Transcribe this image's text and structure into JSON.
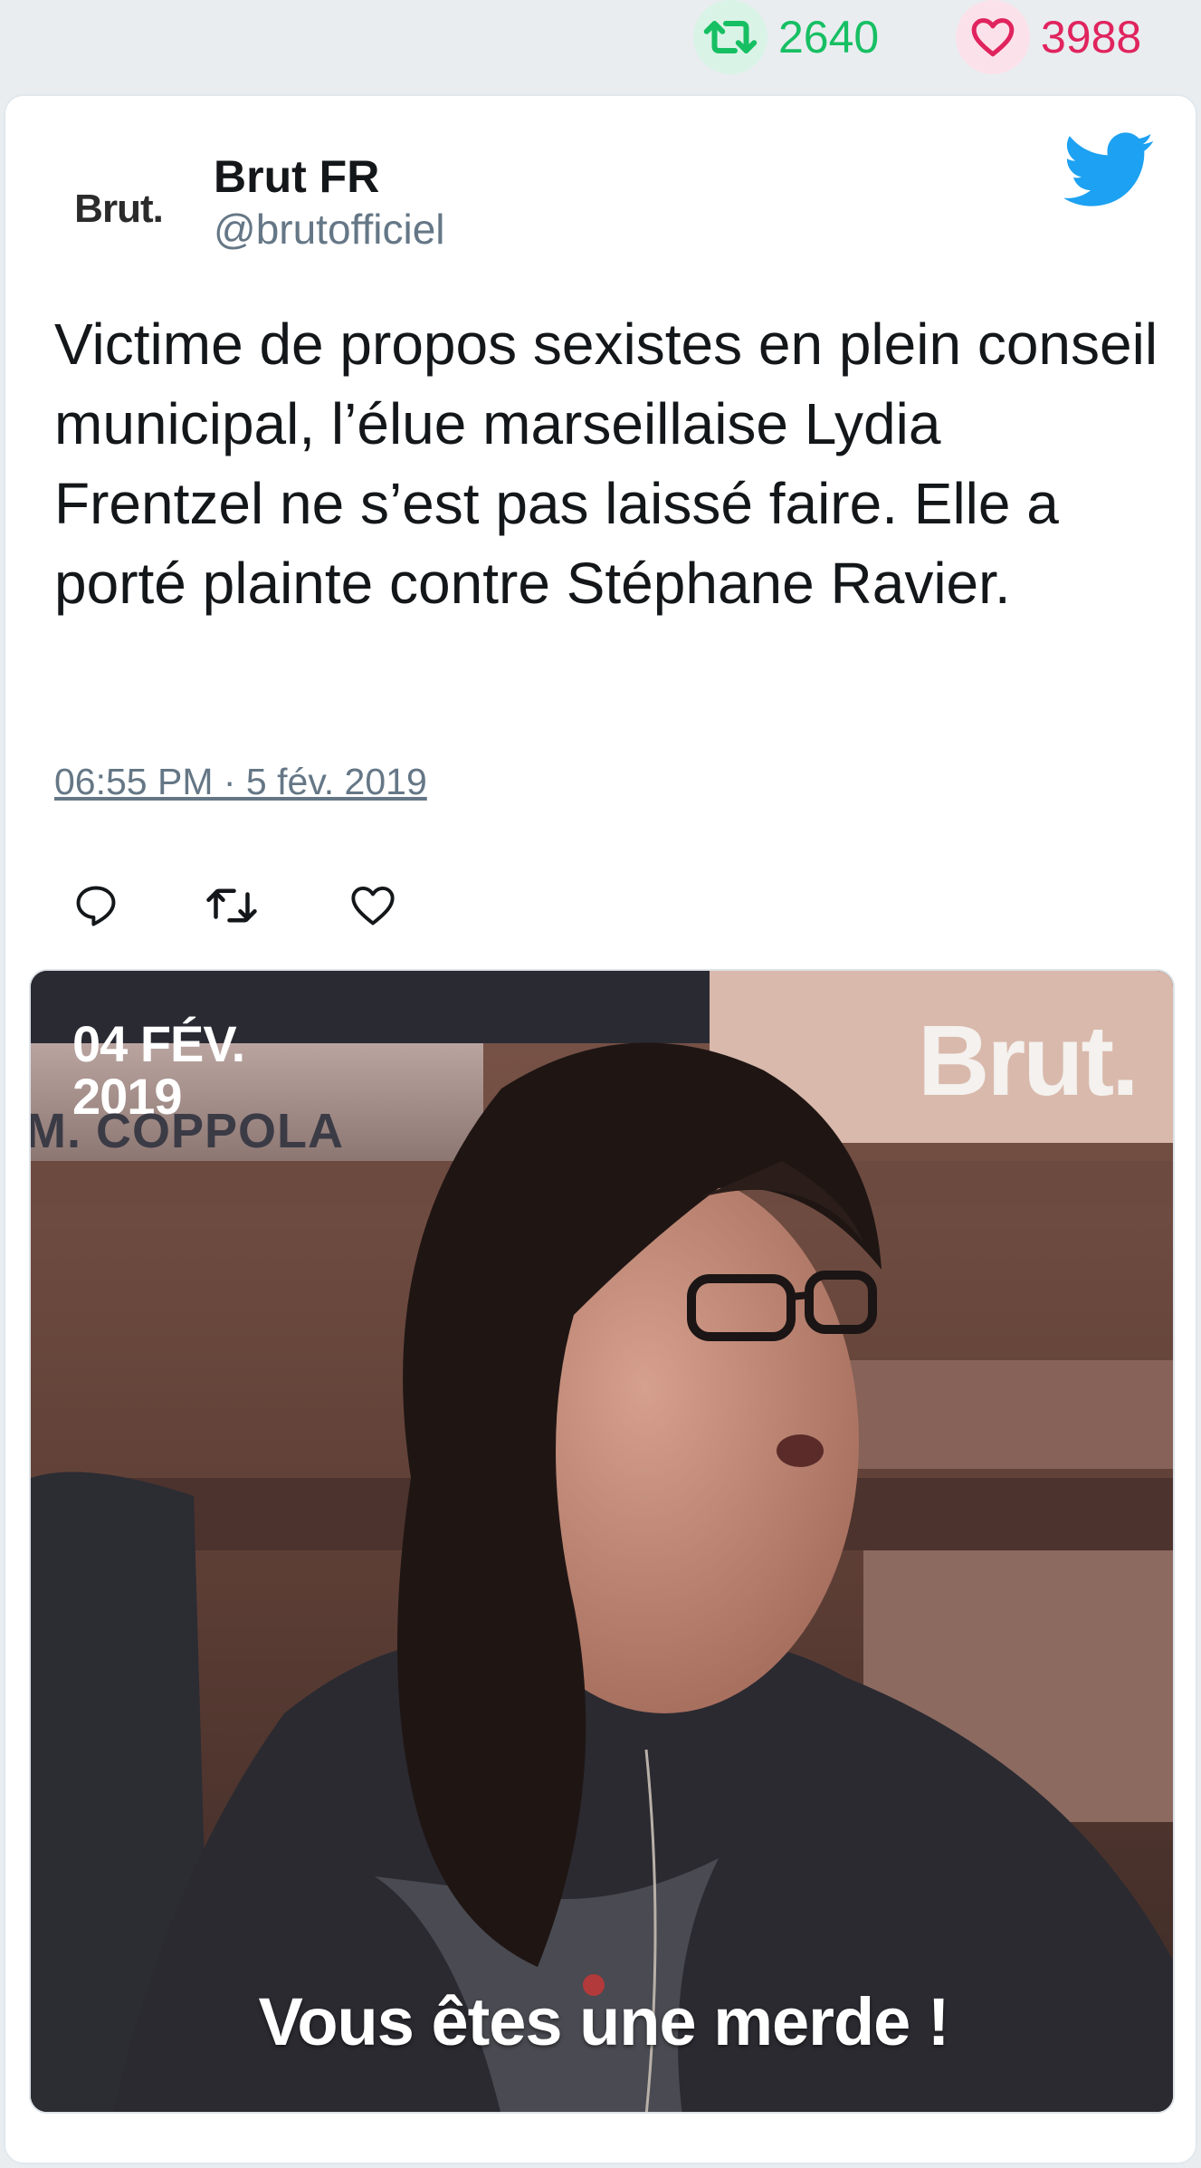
{
  "stats": {
    "retweet_count": "2640",
    "like_count": "3988",
    "retweet_color": "#17bf63",
    "like_color": "#e0245e"
  },
  "tweet": {
    "author_name": "Brut FR",
    "author_handle": "@brutofficiel",
    "avatar_text": "Brut.",
    "text": "Victime de propos sexistes en plein conseil municipal, l’élue marseillaise Lydia Frentzel ne s’est pas laissé faire. Elle a porté plainte contre Stéphane Ravier.",
    "timestamp": "06:55 PM · 5 fév. 2019",
    "icons": {
      "brand": "twitter-bird-icon",
      "reply": "reply-icon",
      "retweet": "retweet-icon",
      "like": "heart-icon"
    }
  },
  "media": {
    "date_line1": "04 FÉV.",
    "date_line2": "2019",
    "nameplate": "M. COPPOLA",
    "brand_watermark": "Brut.",
    "subtitle": "Vous êtes une merde !"
  }
}
